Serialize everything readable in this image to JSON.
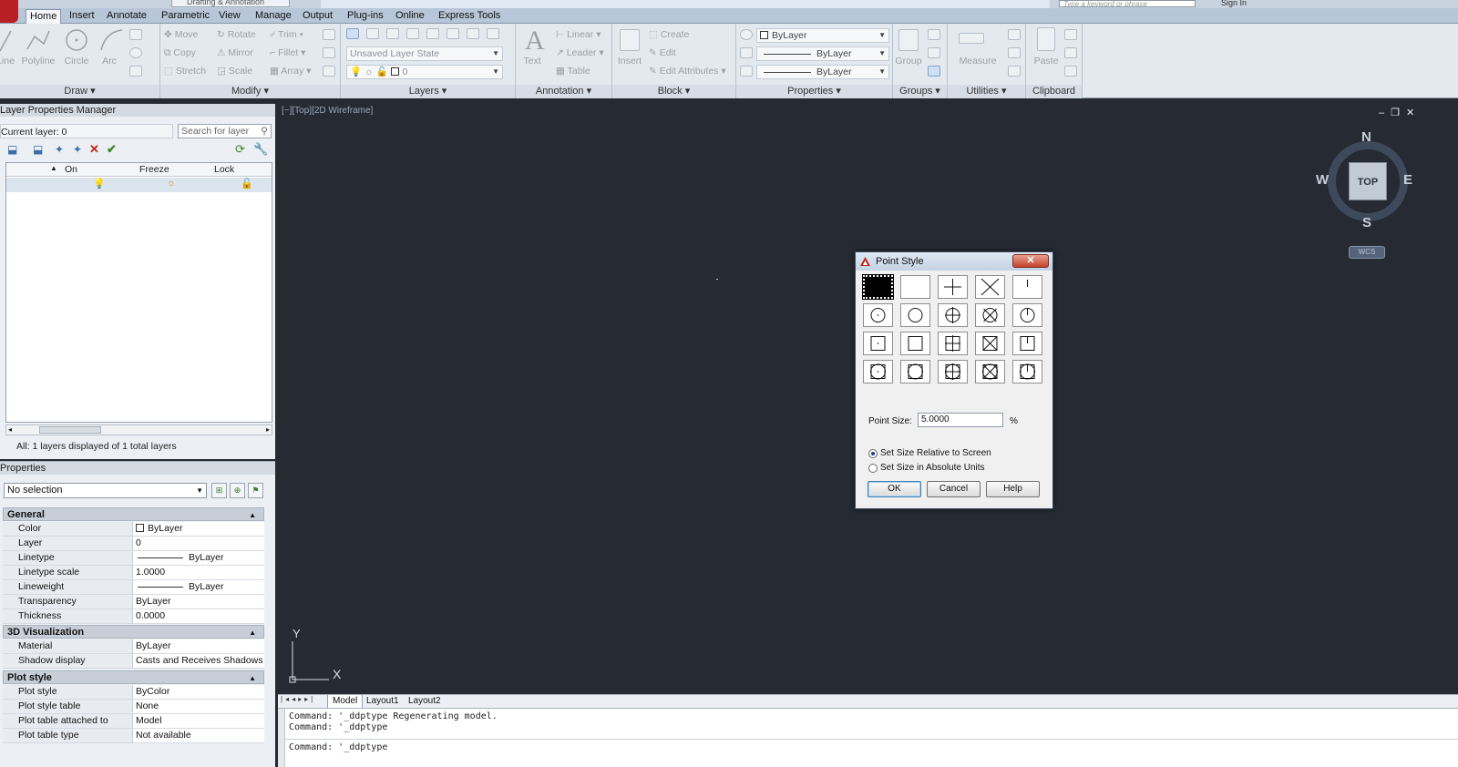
{
  "app": {
    "workspace": "Drafting & Annotation",
    "search_placeholder": "Type a keyword or phrase",
    "sign_in": "Sign In"
  },
  "ribbon_tabs": [
    "Home",
    "Insert",
    "Annotate",
    "Parametric",
    "View",
    "Manage",
    "Output",
    "Plug-ins",
    "Online",
    "Express Tools"
  ],
  "ribbon": {
    "draw": {
      "title": "Draw",
      "line": "Line",
      "polyline": "Polyline",
      "circle": "Circle",
      "arc": "Arc"
    },
    "modify": {
      "title": "Modify",
      "move": "Move",
      "rotate": "Rotate",
      "trim": "Trim",
      "copy": "Copy",
      "mirror": "Mirror",
      "fillet": "Fillet",
      "stretch": "Stretch",
      "scale": "Scale",
      "array": "Array"
    },
    "layers": {
      "title": "Layers",
      "layer_state": "Unsaved Layer State",
      "current": "0"
    },
    "annotation": {
      "title": "Annotation",
      "text": "Text",
      "linear": "Linear",
      "leader": "Leader",
      "table": "Table"
    },
    "block": {
      "title": "Block",
      "insert": "Insert",
      "create": "Create",
      "edit": "Edit",
      "edit_attributes": "Edit Attributes"
    },
    "properties": {
      "title": "Properties",
      "color": "ByLayer",
      "linetype": "ByLayer",
      "lineweight": "ByLayer"
    },
    "groups": {
      "title": "Groups",
      "group": "Group"
    },
    "utilities": {
      "title": "Utilities",
      "measure": "Measure"
    },
    "clipboard": {
      "title": "Clipboard",
      "paste": "Paste"
    }
  },
  "layer_manager": {
    "title": "Layer Properties Manager",
    "current_layer": "Current layer: 0",
    "search_placeholder": "Search for layer",
    "columns": [
      "On",
      "Freeze",
      "Lock"
    ],
    "status": "All: 1 layers displayed of 1 total layers"
  },
  "properties": {
    "title": "Properties",
    "selection": "No selection",
    "sections": {
      "general": {
        "title": "General",
        "rows": [
          {
            "key": "Color",
            "value": "ByLayer"
          },
          {
            "key": "Layer",
            "value": "0"
          },
          {
            "key": "Linetype",
            "value": "ByLayer"
          },
          {
            "key": "Linetype scale",
            "value": "1.0000"
          },
          {
            "key": "Lineweight",
            "value": "ByLayer"
          },
          {
            "key": "Transparency",
            "value": "ByLayer"
          },
          {
            "key": "Thickness",
            "value": "0.0000"
          }
        ]
      },
      "visualization": {
        "title": "3D Visualization",
        "rows": [
          {
            "key": "Material",
            "value": "ByLayer"
          },
          {
            "key": "Shadow display",
            "value": "Casts and Receives Shadows"
          }
        ]
      },
      "plot_style": {
        "title": "Plot style",
        "rows": [
          {
            "key": "Plot style",
            "value": "ByColor"
          },
          {
            "key": "Plot style table",
            "value": "None"
          },
          {
            "key": "Plot table attached to",
            "value": "Model"
          },
          {
            "key": "Plot table type",
            "value": "Not available"
          }
        ]
      }
    }
  },
  "viewport": {
    "label": "[−][Top][2D Wireframe]",
    "viewcube": {
      "face": "TOP",
      "n": "N",
      "s": "S",
      "e": "E",
      "w": "W",
      "wcs": "WCS"
    },
    "ucs": {
      "x": "X",
      "y": "Y"
    }
  },
  "layout_tabs": [
    "Model",
    "Layout1",
    "Layout2"
  ],
  "command_line": {
    "history": [
      "Command: '_ddptype Regenerating model.",
      "Command: '_ddptype"
    ],
    "current": "Command: '_ddptype"
  },
  "point_style_dialog": {
    "title": "Point Style",
    "close": "✕",
    "point_size_label": "Point Size:",
    "point_size_value": "5.0000",
    "unit": "%",
    "option_relative": "Set Size Relative to Screen",
    "option_absolute": "Set Size in Absolute Units",
    "selected_option": "relative",
    "selected_style": 0,
    "styles": [
      "dot",
      "none",
      "plus",
      "cross",
      "tick",
      "circle-dot",
      "circle",
      "circle-plus",
      "circle-cross",
      "circle-tick",
      "square-dot",
      "square",
      "square-plus",
      "square-cross",
      "square-tick",
      "circle-square-dot",
      "circle-square",
      "circle-square-plus",
      "circle-square-cross",
      "circle-square-tick"
    ],
    "ok": "OK",
    "cancel": "Cancel",
    "help": "Help"
  }
}
